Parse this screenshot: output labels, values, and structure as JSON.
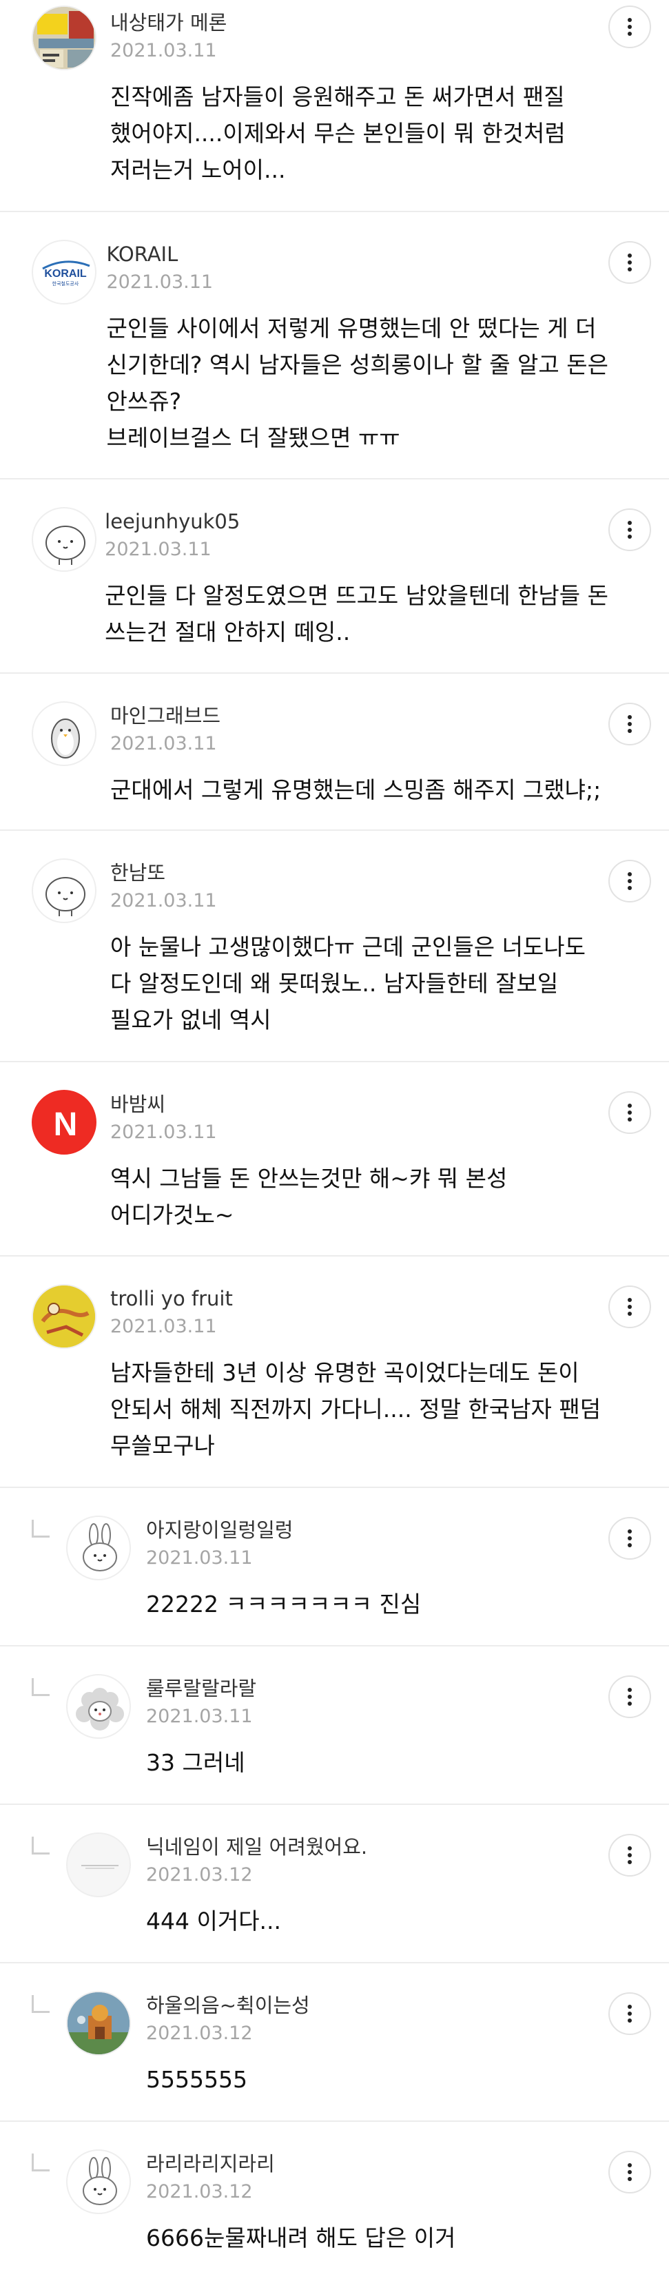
{
  "comments": [
    {
      "author": "내상태가 메론",
      "date": "2021.03.11",
      "lines": [
        "진작에좀 남자들이 응원해주고 돈 써가면서 팬질",
        "했어야지....이제와서 무슨 본인들이 뭐 한것처럼",
        "저러는거 노어이..."
      ],
      "avatar": "photo-avatar-yellow-sign",
      "reply": false
    },
    {
      "author": "KORAIL",
      "date": "2021.03.11",
      "lines": [
        "군인들 사이에서 저렇게 유명했는데 안 떴다는 게 더",
        "신기한데? 역시 남자들은 성희롱이나 할 줄 알고 돈은",
        "안쓰쥬?",
        "브레이브걸스 더 잘됐으면 ㅠㅠ"
      ],
      "avatar": "korail-logo",
      "logo_text": "KORAIL",
      "logo_sub": "한국철도공사",
      "reply": false
    },
    {
      "author": "leejunhyuk05",
      "date": "2021.03.11",
      "lines": [
        "군인들 다 알정도였으면 뜨고도 남았을텐데 한남들 돈",
        "쓰는건 절대 안하지 떼잉.."
      ],
      "avatar": "round-creature-avatar",
      "reply": false
    },
    {
      "author": "마인그래브드",
      "date": "2021.03.11",
      "lines": [
        "군대에서 그렇게 유명했는데 스밍좀 해주지 그랬냐;;"
      ],
      "avatar": "penguin-avatar",
      "reply": false
    },
    {
      "author": "한남또",
      "date": "2021.03.11",
      "lines": [
        "아 눈물나 고생많이했다ㅠ 근데 군인들은 너도나도",
        "다 알정도인데 왜 못떠웠노.. 남자들한테 잘보일",
        "필요가 없네 역시"
      ],
      "avatar": "round-creature-avatar",
      "reply": false
    },
    {
      "author": "바밤씨",
      "date": "2021.03.11",
      "lines": [
        "역시 그남들 돈 안쓰는것만 해~캬 뭐 본성",
        "어디가것노~"
      ],
      "avatar": "red-n-avatar",
      "avatar_letter": "N",
      "reply": false
    },
    {
      "author": "trolli yo fruit",
      "date": "2021.03.11",
      "lines": [
        "남자들한테 3년 이상 유명한 곡이었다는데도 돈이",
        "안되서 해체 직전까지 가다니.... 정말 한국남자 팬덤",
        "무쓸모구나"
      ],
      "avatar": "yellow-illustration-avatar",
      "reply": false
    },
    {
      "author": "아지랑이일렁일렁",
      "date": "2021.03.11",
      "lines": [
        "22222 ㅋㅋㅋㅋㅋㅋㅋ 진심"
      ],
      "avatar": "bunny-avatar",
      "reply": true
    },
    {
      "author": "룰루랄랄라랄",
      "date": "2021.03.11",
      "lines": [
        "33 그러네"
      ],
      "avatar": "sheep-avatar",
      "reply": true
    },
    {
      "author": "닉네임이 제일 어려웠어요.",
      "date": "2021.03.12",
      "lines": [
        "444 이거다..."
      ],
      "avatar": "blank-avatar",
      "reply": true
    },
    {
      "author": "하울의음~췩이는성",
      "date": "2021.03.12",
      "lines": [
        "5555555"
      ],
      "avatar": "photo-avatar-castle",
      "reply": true
    },
    {
      "author": "라리라리지라리",
      "date": "2021.03.12",
      "lines": [
        "6666눈물짜내려 해도 답은 이거"
      ],
      "avatar": "bunny-avatar",
      "reply": true
    }
  ],
  "colors": {
    "author": "#333333",
    "date": "#a5a5a5",
    "divider": "#ececec",
    "red_avatar": "#ee2b23",
    "yellow_avatar": "#e5cd2f"
  }
}
